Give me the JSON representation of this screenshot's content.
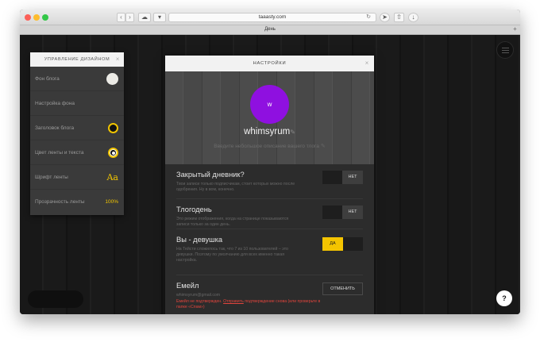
{
  "browser": {
    "url": "taaasty.com",
    "tab_title": "День",
    "new_tab": "+"
  },
  "design_panel": {
    "title": "УПРАВЛЕНИЕ ДИЗАЙНОМ",
    "close": "×",
    "rows": [
      {
        "label": "Фон блога"
      },
      {
        "label": "Настройка фона"
      },
      {
        "label": "Заголовок блога"
      },
      {
        "label": "Цвет ленты и текста"
      },
      {
        "label": "Шрифт ленты",
        "value": "Aa"
      },
      {
        "label": "Прозрачность ленты",
        "value": "100%"
      }
    ],
    "accent_color": "#f0c400"
  },
  "settings": {
    "title": "НАСТРОЙКИ",
    "close": "×",
    "avatar_letter": "w",
    "avatar_color": "#8f10e0",
    "username": "whimsyrum",
    "blog_description_placeholder": "Введите небольшое описание вашего тлога",
    "private": {
      "title": "Закрытый дневник?",
      "desc": "Твои записи только подписчикам, стоит которых можно после одобрения. Ну в вом, конечно.",
      "toggle": "НЕТ"
    },
    "tlogoday": {
      "title": "Тлогодень",
      "desc": "Это режим отображения, когда на странице показываются записи только за один день.",
      "toggle": "НЕТ"
    },
    "female": {
      "title": "Вы - девушка",
      "desc": "На Тейсти cложилось так, что 7 из 10 пользователей – это девушки. Поэтому по умолчанию для всех именно такая настройка.",
      "toggle": "ДА"
    },
    "email": {
      "title": "Емейл",
      "value": "whimsyrum@gmail.com",
      "warning_prefix": "Емейл не подтвержден.",
      "warning_link": "Отправить",
      "warning_suffix": "подтверждение снова (или проверьте в папке «Спам»)",
      "button": "ОТМЕНИТЬ"
    }
  },
  "help_button": "?"
}
